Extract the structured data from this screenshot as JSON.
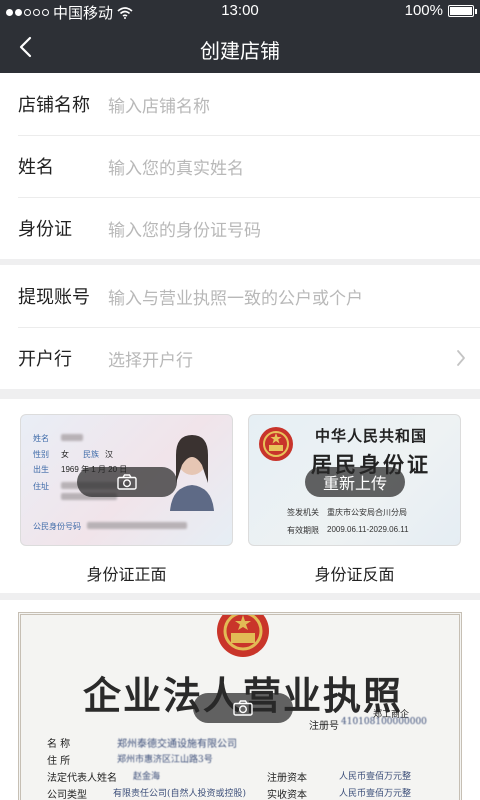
{
  "status_bar": {
    "carrier": "中国移动",
    "time": "13:00",
    "battery": "100%"
  },
  "nav": {
    "title": "创建店铺"
  },
  "form_group_1": [
    {
      "label": "店铺名称",
      "placeholder": "输入店铺名称"
    },
    {
      "label": "姓名",
      "placeholder": "输入您的真实姓名"
    },
    {
      "label": "身份证",
      "placeholder": "输入您的身份证号码"
    }
  ],
  "form_group_2": [
    {
      "label": "提现账号",
      "placeholder": "输入与营业执照一致的公户或个户"
    },
    {
      "label": "开户行",
      "placeholder": "选择开户行"
    }
  ],
  "id_cards": {
    "front_label": "身份证正面",
    "back_label": "身份证反面",
    "reupload_label": "重新上传",
    "front": {
      "name_field": "姓名",
      "gender_field": "性别",
      "gender": "女",
      "ethnicity_field": "民族",
      "ethnicity": "汉",
      "birth_field": "出生",
      "birth": "1969 年 1 月 20 日",
      "address_field": "住址",
      "id_number_field": "公民身份号码"
    },
    "back": {
      "country": "中华人民共和国",
      "card_title": "居民身份证",
      "issuer_field": "签发机关",
      "issuer": "重庆市公安局合川分局",
      "validity_field": "有效期限",
      "validity": "2009.06.11-2029.06.11"
    }
  },
  "license": {
    "title": "企业法人营业执照",
    "registry": "郑工商企",
    "reg_no_field": "注册号",
    "reg_no": "410108100000000",
    "name_field": "名   称",
    "company_name": "郑州泰德交通设施有限公司",
    "address_field": "住   所",
    "address": "郑州市惠济区江山路3号",
    "rep_field": "法定代表人姓名",
    "rep": "赵金海",
    "type_field": "公司类型",
    "type": "有限责任公司(自然人投资或控股)",
    "capital_field": "注册资本",
    "capital": "人民币壹佰万元整",
    "paid_field": "实收资本",
    "paid": "人民币壹佰万元整"
  },
  "colors": {
    "nav_bg": "#2d3036",
    "placeholder": "#b8b8b8",
    "page_bg": "#efeff0"
  }
}
